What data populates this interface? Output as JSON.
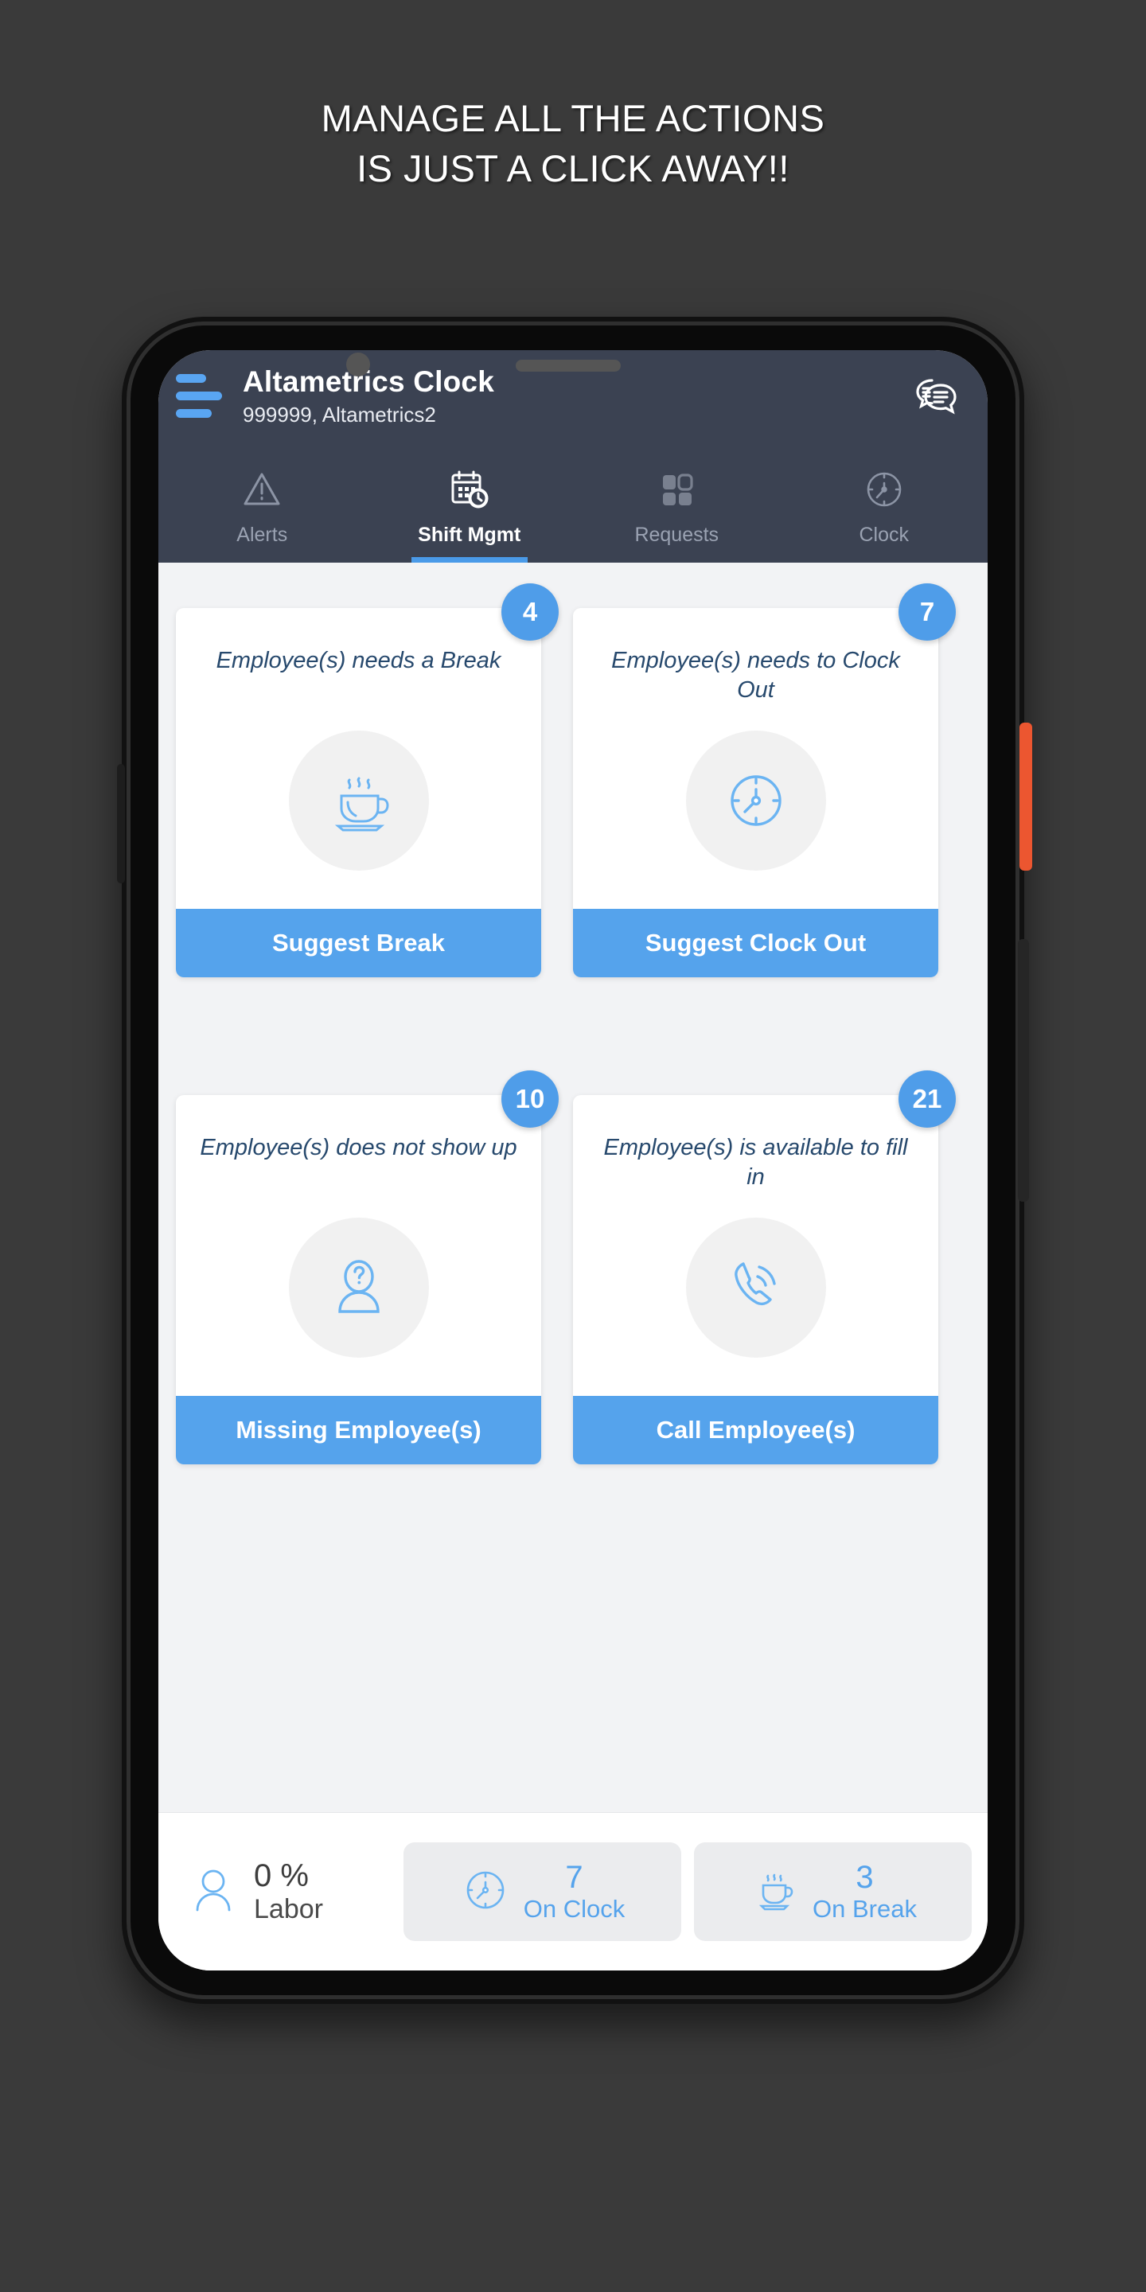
{
  "promo": {
    "line1": "MANAGE ALL THE ACTIONS",
    "line2": "IS JUST A CLICK AWAY!!"
  },
  "app": {
    "title": "Altametrics Clock",
    "subtitle": "999999, Altametrics2",
    "menu_icon": "hamburger-icon",
    "chat_icon": "chat-bubbles-icon"
  },
  "tabs": [
    {
      "label": "Alerts",
      "icon": "warning-triangle-icon",
      "active": false
    },
    {
      "label": "Shift Mgmt",
      "icon": "calendar-clock-icon",
      "active": true
    },
    {
      "label": "Requests",
      "icon": "grid-squares-icon",
      "active": false
    },
    {
      "label": "Clock",
      "icon": "clock-icon",
      "active": false
    }
  ],
  "cards": [
    {
      "text": "Employee(s) needs a Break",
      "badge": "4",
      "button": "Suggest Break",
      "icon": "coffee-cup-icon"
    },
    {
      "text": "Employee(s) needs to Clock Out",
      "badge": "7",
      "button": "Suggest Clock Out",
      "icon": "clock-icon"
    },
    {
      "text": "Employee(s) does not show up",
      "badge": "10",
      "button": "Missing Employee(s)",
      "icon": "person-question-icon"
    },
    {
      "text": "Employee(s) is available to fill in",
      "badge": "21",
      "button": "Call Employee(s)",
      "icon": "phone-call-icon"
    }
  ],
  "bottombar": {
    "labor": {
      "value": "0 %",
      "label": "Labor",
      "icon": "person-icon"
    },
    "stats": [
      {
        "value": "7",
        "label": "On Clock",
        "icon": "clock-icon"
      },
      {
        "value": "3",
        "label": "On Break",
        "icon": "coffee-cup-icon"
      }
    ]
  },
  "colors": {
    "accent": "#55a3ec",
    "header": "#3b4252",
    "badge": "#4f9de9",
    "card_text": "#27496d",
    "page_bg": "#3a3a3a"
  }
}
